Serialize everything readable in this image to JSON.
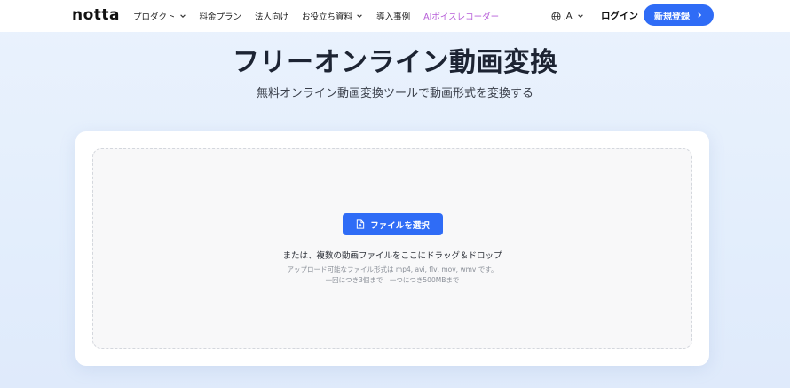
{
  "header": {
    "logo": "notta",
    "nav": [
      {
        "label": "プロダクト",
        "dropdown": true
      },
      {
        "label": "料金プラン",
        "dropdown": false
      },
      {
        "label": "法人向け",
        "dropdown": false
      },
      {
        "label": "お役立ち資料",
        "dropdown": true
      },
      {
        "label": "導入事例",
        "dropdown": false
      },
      {
        "label": "AIボイスレコーダー",
        "dropdown": false
      }
    ],
    "language": "JA",
    "login_label": "ログイン",
    "signup_label": "新規登録"
  },
  "hero": {
    "title": "フリーオンライン動画変換",
    "subtitle": "無料オンライン動画変換ツールで動画形式を変換する"
  },
  "upload": {
    "button_label": "ファイルを選択",
    "drop_text": "または、複数の動画ファイルをここにドラッグ＆ドロップ",
    "formats_text": "アップロード可能なファイル形式は mp4, avi, flv, mov, wmv です。",
    "limits_text": "一回につき3個まで　一つにつき500MBまで"
  },
  "colors": {
    "accent": "#2f6cf6",
    "ai_link": "#b65cd8",
    "background": "#e6f0fc"
  },
  "icons": [
    "chevron-down-icon",
    "globe-icon",
    "chevron-right-icon",
    "file-upload-icon"
  ]
}
